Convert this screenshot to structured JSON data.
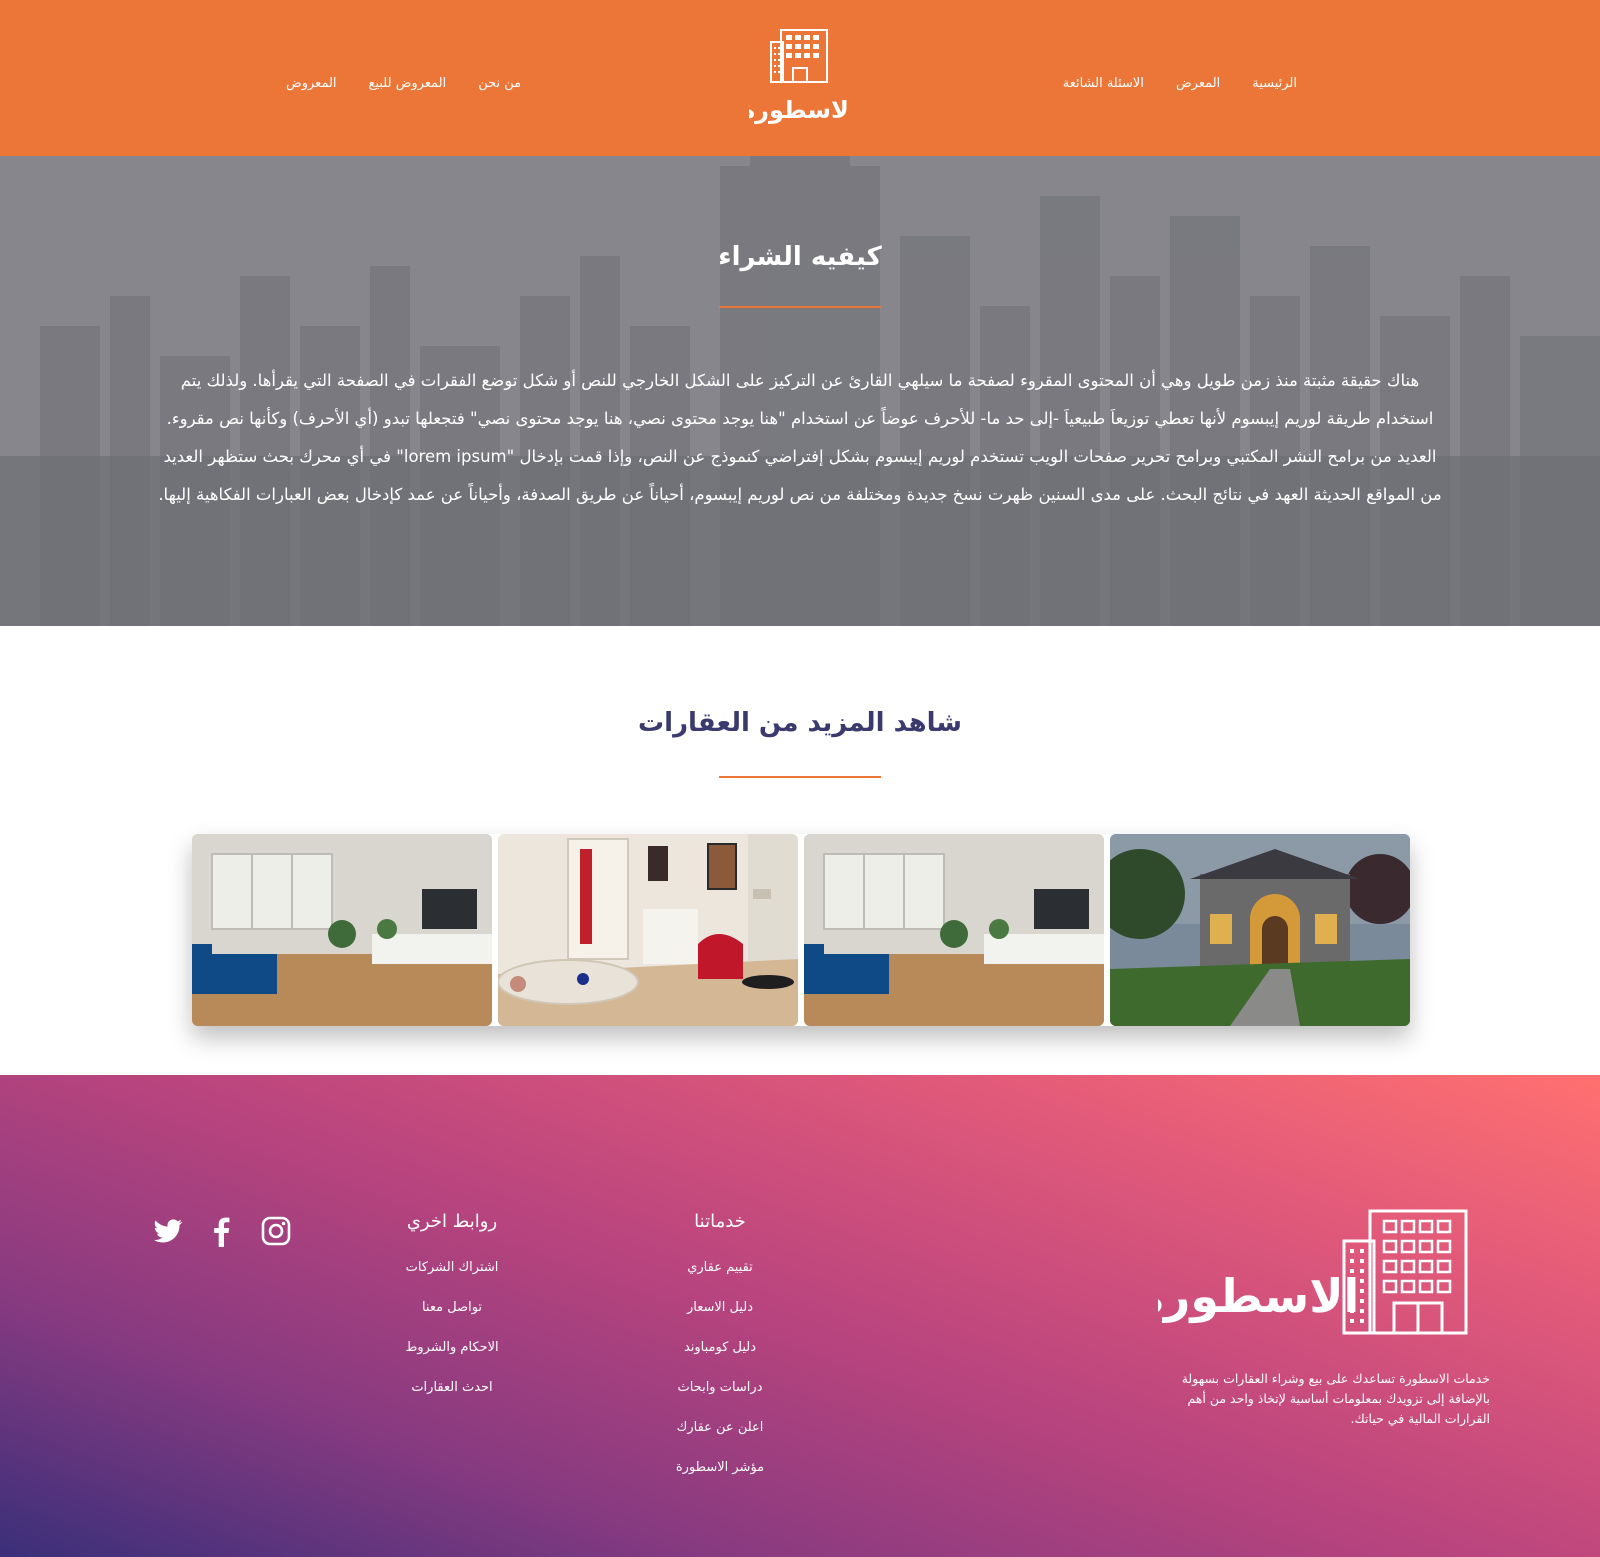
{
  "brand": {
    "name": "الاسطورة",
    "color": "#ec7638"
  },
  "nav": {
    "right": [
      {
        "label": "الرئيسية"
      },
      {
        "label": "المعرض"
      },
      {
        "label": "الاسئلة الشائعة"
      }
    ],
    "left": [
      {
        "label": "من نحن"
      },
      {
        "label": "المعروض للبيع"
      },
      {
        "label": "المعروض"
      }
    ]
  },
  "hero": {
    "title": "كيفيه الشراء",
    "text": "هناك حقيقة مثبتة منذ زمن طويل وهي أن المحتوى المقروء لصفحة ما سيلهي القارئ عن التركيز على الشكل الخارجي للنص أو شكل توضع الفقرات في الصفحة التي يقرأها. ولذلك يتم استخدام طريقة لوريم إيبسوم لأنها تعطي توزيعاَ طبيعياَ -إلى حد ما- للأحرف عوضاً عن استخدام \"هنا يوجد محتوى نصي، هنا يوجد محتوى نصي\" فتجعلها تبدو (أي الأحرف) وكأنها نص مقروء. العديد من برامح النشر المكتبي وبرامح تحرير صفحات الويب تستخدم لوريم إيبسوم بشكل إفتراضي كنموذج عن النص، وإذا قمت بإدخال \"lorem ipsum\" في أي محرك بحث ستظهر العديد من المواقع الحديثة العهد في نتائج البحث. على مدى السنين ظهرت نسخ جديدة ومختلفة من نص لوريم إيبسوم، أحياناً عن طريق الصدفة، وأحياناً عن عمد كإدخال بعض العبارات الفكاهية إليها."
  },
  "more": {
    "title": "شاهد المزيد من العقارات",
    "photos": [
      {
        "icon": "living-room-photo"
      },
      {
        "icon": "red-armchair-room-photo"
      },
      {
        "icon": "living-room-photo"
      },
      {
        "icon": "house-exterior-photo"
      }
    ]
  },
  "footer": {
    "about": "خدمات الاسطورة تساعدك على بيع وشراء العقارات بسهولة بالإضافة إلى تزويدك بمعلومات أساسية لإتخاذ واحد من أهم القرارات المالية في حياتك.",
    "services": {
      "title": "خدماتنا",
      "items": [
        "تقييم عقاري",
        "دليل الاسعار",
        "دليل كومباوند",
        "دراسات وابحاث",
        "اعلن عن عقارك",
        "مؤشر الاسطورة"
      ]
    },
    "links": {
      "title": "روابط اخري",
      "items": [
        "اشتراك الشركات",
        "تواصل معنا",
        "الاحكام والشروط",
        "احدث العقارات"
      ]
    },
    "social": [
      "twitter-icon",
      "facebook-icon",
      "instagram-icon"
    ]
  }
}
